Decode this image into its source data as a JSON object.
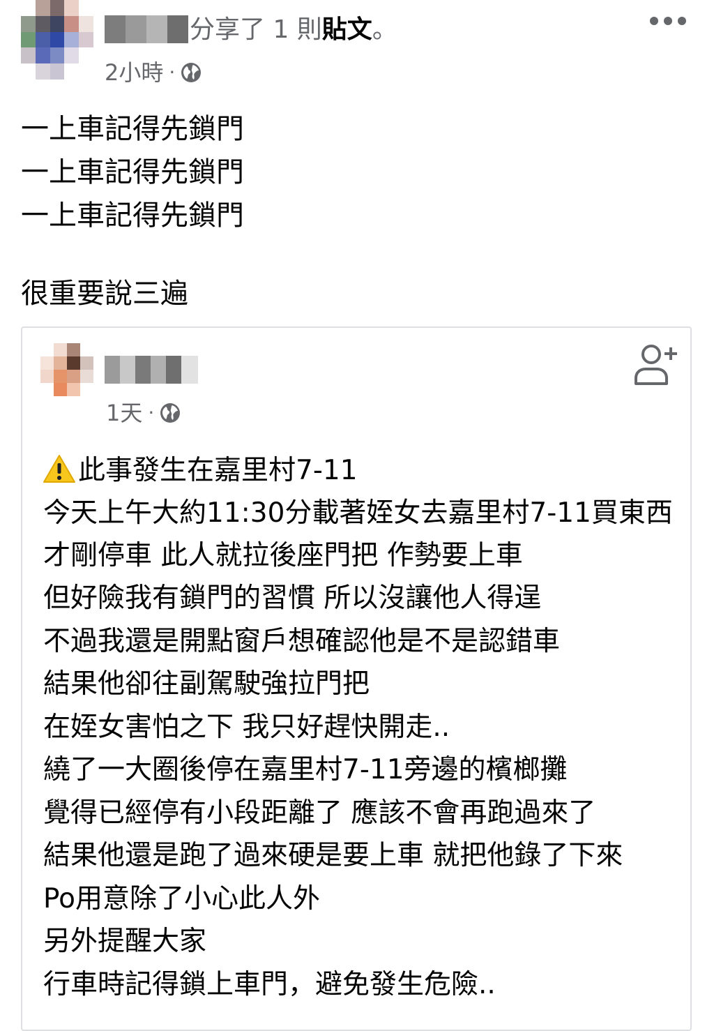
{
  "post": {
    "share_text": "分享了 1 則",
    "post_word": "貼文",
    "period": "。",
    "time": "2小時",
    "separator": "·",
    "body_lines": [
      "一上車記得先鎖門",
      "一上車記得先鎖門",
      "一上車記得先鎖門"
    ],
    "closing_line": "很重要說三遍"
  },
  "shared": {
    "time": "1天",
    "separator": "·",
    "first_line": "此事發生在嘉里村7-11",
    "lines": [
      "今天上午大約11:30分載著姪女去嘉里村7-11買東西",
      "才剛停車 此人就拉後座門把 作勢要上車",
      "但好險我有鎖門的習慣 所以沒讓他人得逞",
      "不過我還是開點窗戶想確認他是不是認錯車",
      "結果他卻往副駕駛強拉門把",
      "在姪女害怕之下 我只好趕快開走..",
      "繞了一大圈後停在嘉里村7-11旁邊的檳榔攤",
      "覺得已經停有小段距離了 應該不會再跑過來了",
      "結果他還是跑了過來硬是要上車 就把他錄了下來",
      "Po用意除了小心此人外",
      "另外提醒大家",
      "行車時記得鎖上車門，避免發生危險.."
    ]
  },
  "icons": {
    "more": "more-options-icon",
    "globe": "globe-icon",
    "add_friend": "add-friend-icon",
    "warning": "warning-icon"
  },
  "colors": {
    "secondary_text": "#65676b",
    "primary_text": "#050505",
    "card_border": "#dddfe2",
    "warning": "#f7c71d"
  }
}
